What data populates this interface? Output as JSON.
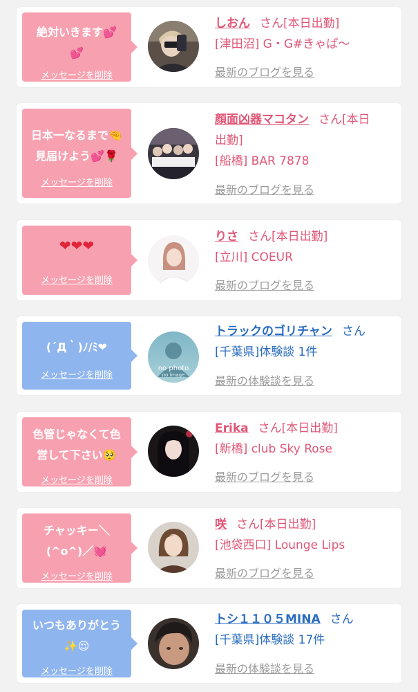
{
  "colors": {
    "pink_bubble": "#f7a1b0",
    "blue_bubble": "#8fb5ef",
    "pink_text": "#e05777",
    "blue_text": "#2a6cc0",
    "link_gray": "#9b9b9b"
  },
  "items": [
    {
      "msg_line1": "絶対いきます💕",
      "msg_line2": "💕",
      "delete": "メッセージを削除",
      "name": "しおん",
      "suffix": "さん[本日出勤]",
      "shop": "[津田沼] G・G#きゃぱ〜",
      "link": "最新のブログを見る"
    },
    {
      "msg_line1": "日本一なるまで🤏",
      "msg_line2": "見届けよう💕🌹",
      "delete": "メッセージを削除",
      "name": "顔面凶器マコタン",
      "suffix": "さん[本日",
      "suffix2": "出勤]",
      "shop": "[船橋] BAR 7878",
      "link": "最新のブログを見る"
    },
    {
      "msg_line1": "❤❤❤",
      "delete": "メッセージを削除",
      "name": "りさ",
      "suffix": "さん[本日出勤]",
      "shop": "[立川] COEUR",
      "link": "最新のブログを見る"
    },
    {
      "msg_line1": "(´Д｀)ﾉ/ﾐ❤",
      "delete": "メッセージを削除",
      "avatar_text1": "no photo",
      "avatar_text2": "no image",
      "name": "トラックのゴリチャン",
      "suffix": "さん",
      "shop": "[千葉県]体験談 1件",
      "link": "最新の体験談を見る"
    },
    {
      "msg_line1": "色管じゃなくて色",
      "msg_line2": "営して下さい🥺",
      "delete": "メッセージを削除",
      "name": "Erika",
      "suffix": "さん[本日出勤]",
      "shop": "[新橋] club Sky Rose",
      "link": "最新のブログを見る"
    },
    {
      "msg_line1": "チャッキー＼",
      "msg_line2": "(^o^)／💓",
      "delete": "メッセージを削除",
      "name": "咲",
      "suffix": "さん[本日出勤]",
      "shop": "[池袋西口] Lounge Lips",
      "link": "最新のブログを見る"
    },
    {
      "msg_line1": "いつもありがとう",
      "msg_line2": "✨😌",
      "delete": "メッセージを削除",
      "name": "トシ１１０５MINA",
      "suffix": "さん",
      "shop": "[千葉県]体験談 17件",
      "link": "最新の体験談を見る"
    }
  ]
}
